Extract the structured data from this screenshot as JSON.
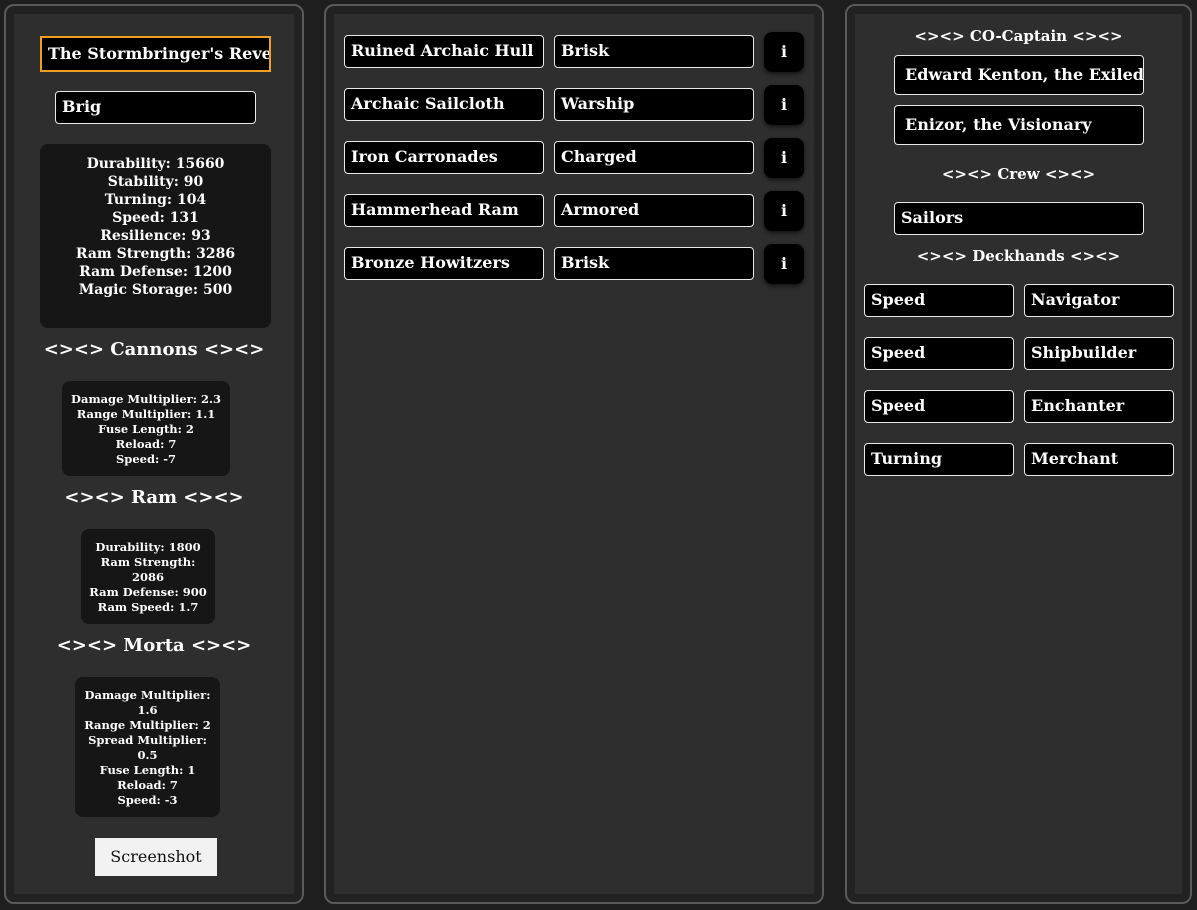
{
  "ship": {
    "name": "The Stormbringer's Revenge",
    "type": "Brig",
    "stats": [
      "Durability: 15660",
      "Stability: 90",
      "Turning: 104",
      "Speed: 131",
      "Resilience: 93",
      "Ram Strength: 3286",
      "Ram Defense: 1200",
      "Magic Storage: 500"
    ]
  },
  "cannons": {
    "heading": "<><> Cannons <><>",
    "stats": [
      "Damage Multiplier: 2.3",
      "Range Multiplier: 1.1",
      "Fuse Length: 2",
      "Reload: 7",
      "Speed: -7"
    ]
  },
  "ram": {
    "heading": "<><> Ram <><>",
    "stats": [
      "Durability: 1800",
      "Ram Strength:",
      "2086",
      "Ram Defense: 900",
      "Ram Speed: 1.7"
    ]
  },
  "morta": {
    "heading": "<><> Morta <><>",
    "stats": [
      "Damage Multiplier:",
      "1.6",
      "Range Multiplier: 2",
      "Spread Multiplier:",
      "0.5",
      "Fuse Length: 1",
      "Reload: 7",
      "Speed: -3"
    ]
  },
  "screenshot_label": "Screenshot",
  "parts": [
    {
      "part": "Ruined Archaic Hull",
      "modifier": "Brisk",
      "info": "i"
    },
    {
      "part": "Archaic Sailcloth",
      "modifier": "Warship",
      "info": "i"
    },
    {
      "part": "Iron Carronades",
      "modifier": "Charged",
      "info": "i"
    },
    {
      "part": "Hammerhead Ram",
      "modifier": "Armored",
      "info": "i"
    },
    {
      "part": "Bronze Howitzers",
      "modifier": "Brisk",
      "info": "i"
    }
  ],
  "co_captain": {
    "heading": "<><> CO-Captain <><>",
    "slots": [
      "Edward Kenton, the Exiled Captain",
      "Enizor, the Visionary"
    ]
  },
  "crew": {
    "heading": "<><> Crew <><>",
    "value": "Sailors"
  },
  "deckhands": {
    "heading": "<><> Deckhands <><>",
    "rows": [
      {
        "stat": "Speed",
        "role": "Navigator"
      },
      {
        "stat": "Speed",
        "role": "Shipbuilder"
      },
      {
        "stat": "Speed",
        "role": "Enchanter"
      },
      {
        "stat": "Turning",
        "role": "Merchant"
      }
    ]
  }
}
